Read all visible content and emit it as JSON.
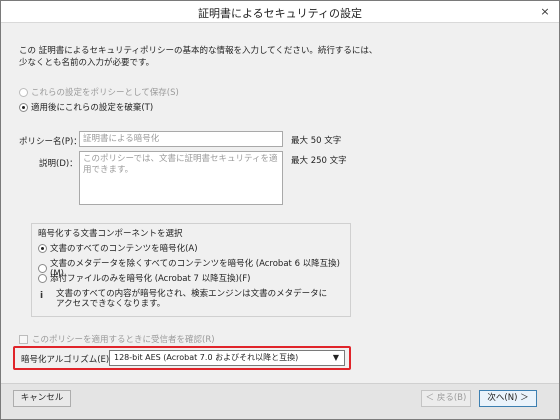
{
  "window": {
    "title": "証明書によるセキュリティの設定",
    "close_glyph": "×"
  },
  "intro": {
    "line1": "この 証明書によるセキュリティポリシーの基本的な情報を入力してください。続行するには、",
    "line2": "少なくとも名前の入力が必要です。"
  },
  "save_mode": {
    "save_as_policy_label": "これらの設定をポリシーとして保存(S)",
    "discard_after_apply_label": "適用後にこれらの設定を破棄(T)"
  },
  "policy": {
    "name_label": "ポリシー名(P)：",
    "name_value": "証明書による暗号化",
    "name_max": "最大 50 文字",
    "desc_label": "説明(D)：",
    "desc_line1": "このポリシーでは、文書に証明書セキュリティを適",
    "desc_line2": "用できます。",
    "desc_max": "最大 250 文字"
  },
  "components": {
    "title": "暗号化する文書コンポーネントを選択",
    "all_contents": "文書のすべてのコンテンツを暗号化(A)",
    "except_metadata": "文書のメタデータを除くすべてのコンテンツを暗号化 (Acrobat 6 以降互換)(M)",
    "attachments_only": "添付ファイルのみを暗号化 (Acrobat 7 以降互換)(F)",
    "info_line1": "文書のすべての内容が暗号化され、検索エンジンは文書のメタデータに",
    "info_line2": "アクセスできなくなります。"
  },
  "confirm_recipients_label": "このポリシーを適用するときに受信者を確認(R)",
  "algorithm": {
    "label": "暗号化アルゴリズム(E)：",
    "selected": "128-bit AES (Acrobat 7.0 およびそれ以降と互換)"
  },
  "buttons": {
    "cancel": "キャンセル",
    "back": "＜ 戻る(B)",
    "next": "次へ(N) ＞"
  }
}
